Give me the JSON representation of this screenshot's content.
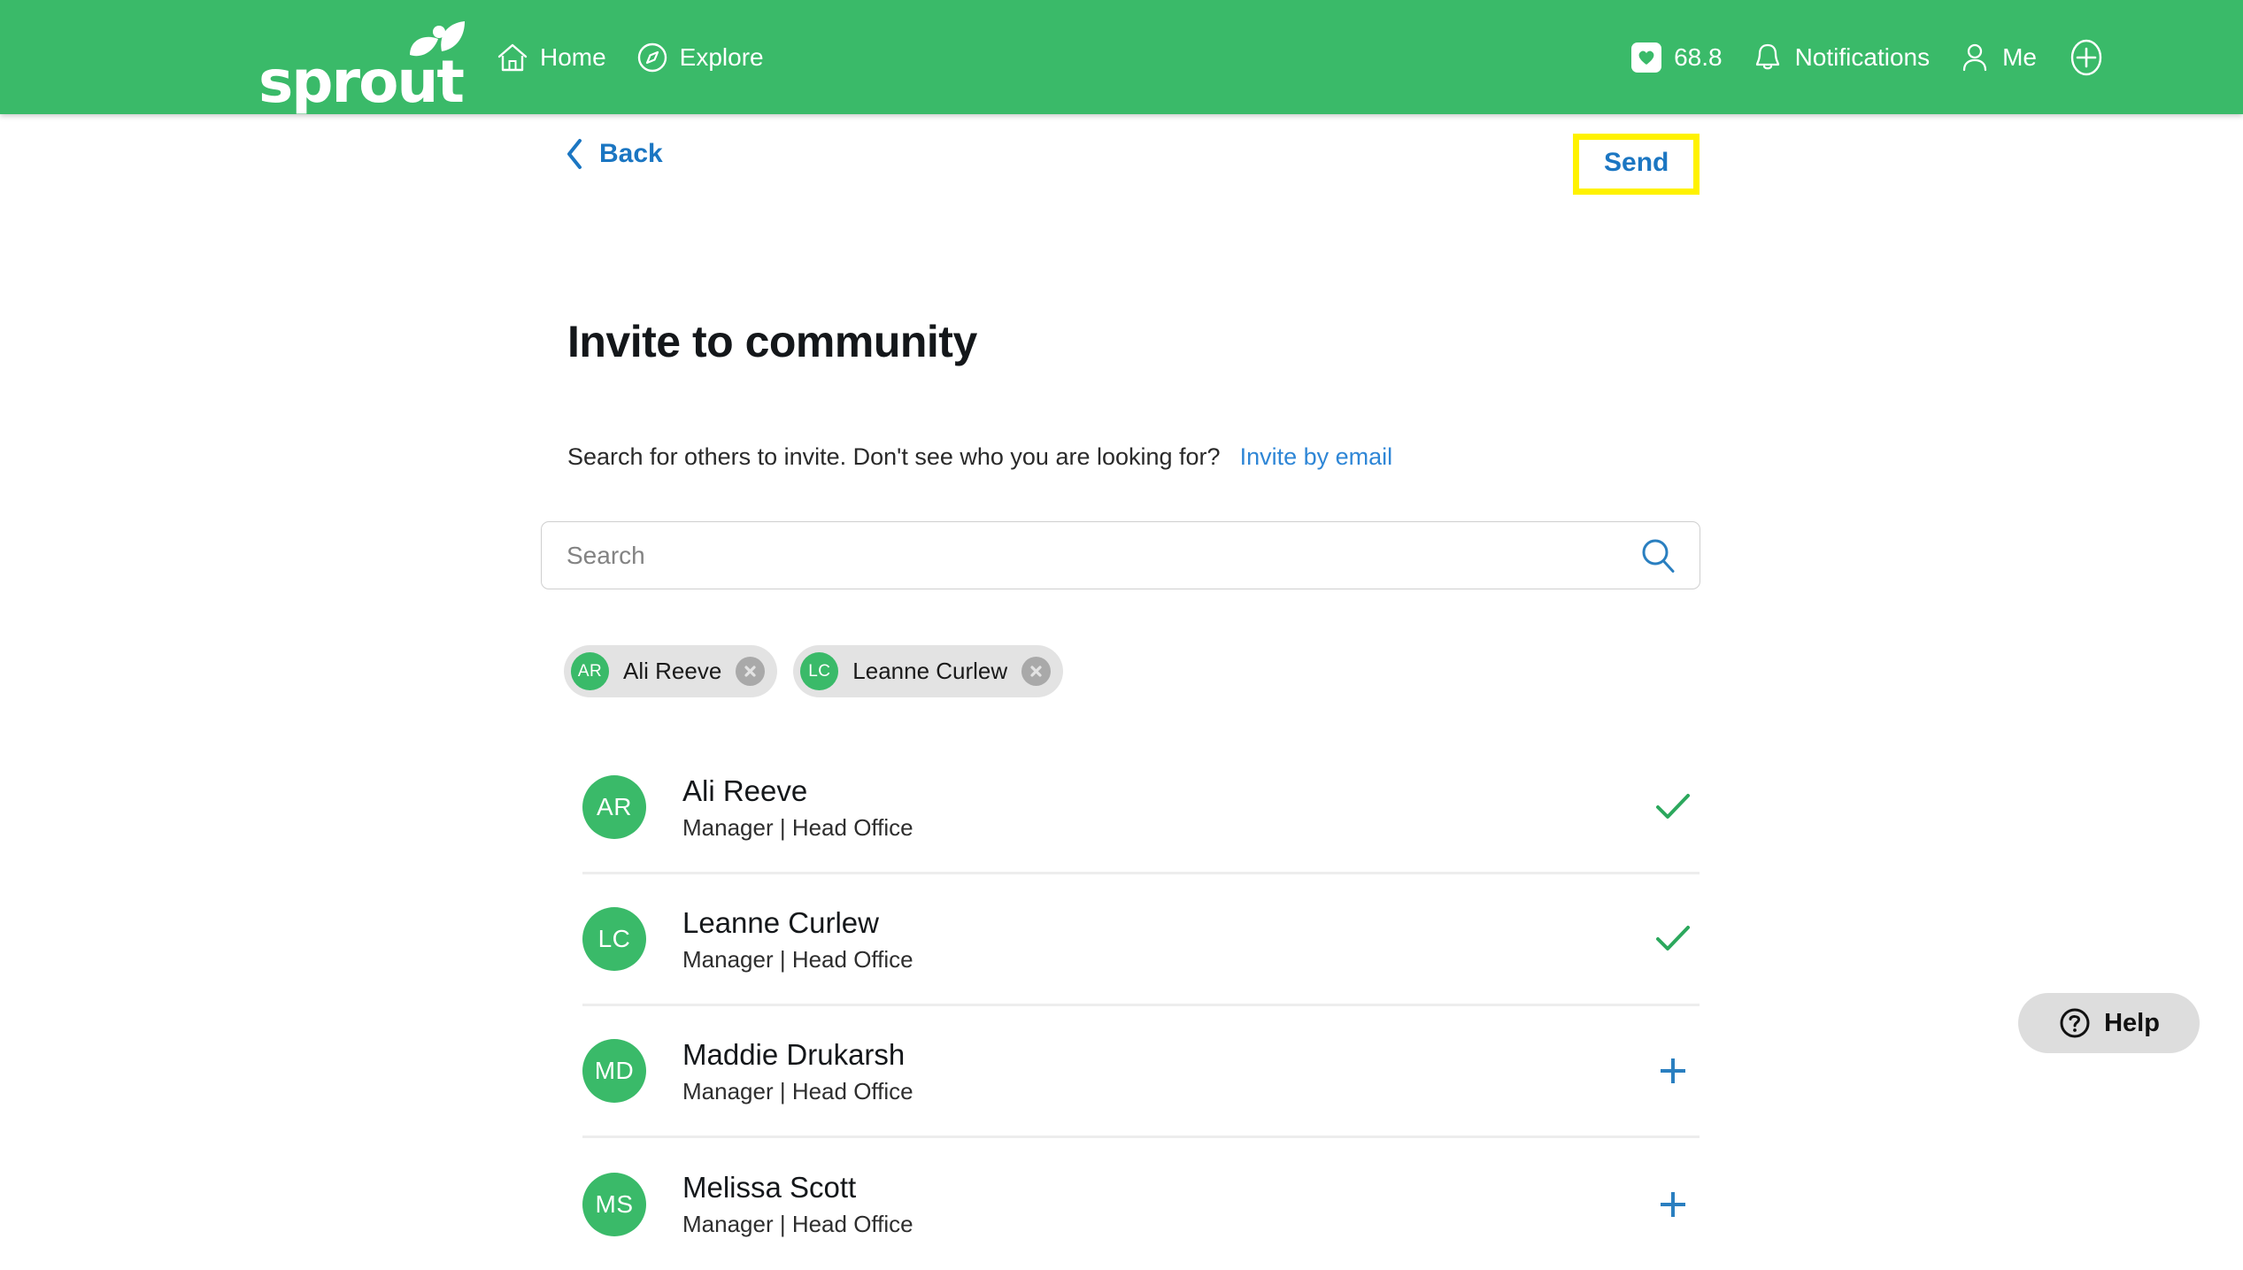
{
  "header": {
    "brand": "sprout",
    "nav": [
      {
        "label": "Home",
        "icon": "home-icon"
      },
      {
        "label": "Explore",
        "icon": "compass-icon"
      }
    ],
    "right": [
      {
        "label": "68.8",
        "icon": "heart-card-icon"
      },
      {
        "label": "Notifications",
        "icon": "bell-icon"
      },
      {
        "label": "Me",
        "icon": "person-icon"
      },
      {
        "label": "",
        "icon": "plus-circle-icon"
      }
    ],
    "brand_green": "#3ABA69"
  },
  "toolbar": {
    "back_label": "Back",
    "send_label": "Send",
    "highlight_color": "#FFF200",
    "link_color": "#1B76C2"
  },
  "main": {
    "title": "Invite to community",
    "description": "Search for others to invite. Don't see who you are looking for?",
    "invite_by_email_label": "Invite by email",
    "search": {
      "placeholder": "Search",
      "value": "",
      "icon": "search-icon"
    },
    "selected_chips": [
      {
        "initials": "AR",
        "name": "Ali Reeve",
        "remove_icon": "close-circle-icon"
      },
      {
        "initials": "LC",
        "name": "Leanne Curlew",
        "remove_icon": "close-circle-icon"
      }
    ],
    "people": [
      {
        "initials": "AR",
        "name": "Ali Reeve",
        "subtitle": "Manager | Head Office",
        "state": "selected",
        "action_icon": "check-icon"
      },
      {
        "initials": "LC",
        "name": "Leanne Curlew",
        "subtitle": "Manager | Head Office",
        "state": "selected",
        "action_icon": "check-icon"
      },
      {
        "initials": "MD",
        "name": "Maddie Drukarsh",
        "subtitle": "Manager | Head Office",
        "state": "unselected",
        "action_icon": "plus-icon"
      },
      {
        "initials": "MS",
        "name": "Melissa Scott",
        "subtitle": "Manager | Head Office",
        "state": "unselected",
        "action_icon": "plus-icon"
      }
    ],
    "avatar_green": "#3ABA69",
    "check_green": "#2CA85D",
    "plus_blue": "#2A7FC0"
  },
  "help": {
    "label": "Help",
    "icon": "question-circle-icon"
  }
}
